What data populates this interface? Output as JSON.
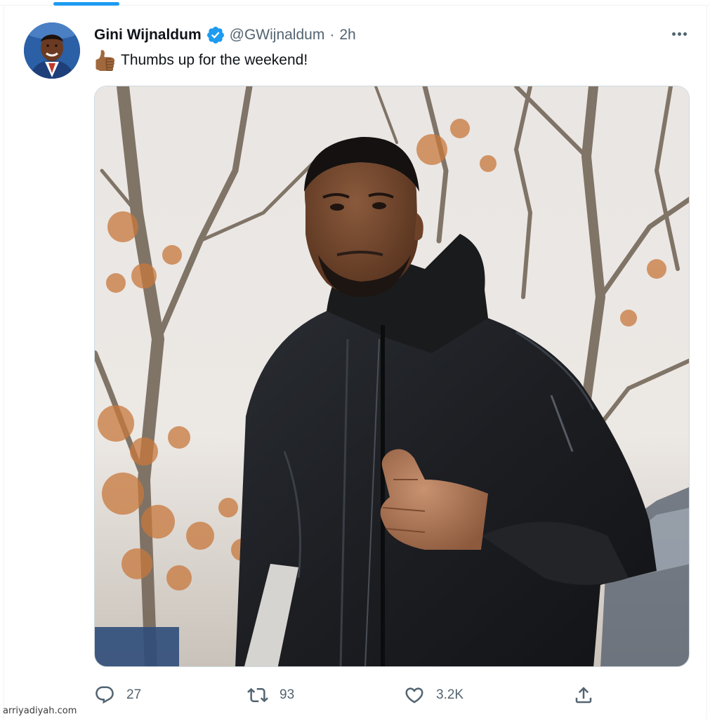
{
  "tweet": {
    "display_name": "Gini Wijnaldum",
    "verified": true,
    "handle": "@GWijnaldum",
    "separator": "·",
    "time": "2h",
    "text": "Thumbs up for the weekend!",
    "emoji": "thumbs-up-emoji",
    "media": "photo-man-in-black-jacket-thumbs-up"
  },
  "actions": {
    "reply_count": "27",
    "retweet_count": "93",
    "like_count": "3.2K"
  },
  "icons": {
    "more": "more-icon",
    "reply": "reply-icon",
    "retweet": "retweet-icon",
    "like": "heart-icon",
    "share": "share-icon",
    "verified": "verified-badge-icon"
  },
  "colors": {
    "accent": "#1d9bf0",
    "text_primary": "#0f1419",
    "text_secondary": "#536471"
  },
  "watermark": "arriyadiyah.com"
}
